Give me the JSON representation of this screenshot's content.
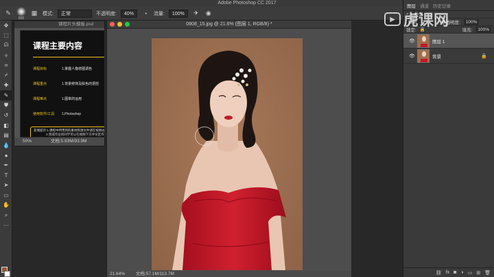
{
  "app": {
    "window_title": "Adobe Photoshop CC 2017"
  },
  "options_bar": {
    "brush_size": "600",
    "mode_label": "模式:",
    "mode_value": "正常",
    "opacity_label": "不透明度:",
    "opacity_value": "40%",
    "flow_label": "流量:",
    "flow_value": "100%"
  },
  "doc_slide": {
    "tab_title": "课程片头模板.psd",
    "heading": "课程主要内容",
    "rows": [
      {
        "key": "课程目标",
        "value": "1.掌握人像修图调色"
      },
      {
        "key": "课程重点",
        "value": "1.背景修饰及肤色的把控"
      },
      {
        "key": "课程难点",
        "value": "1.图章的运用"
      },
      {
        "key": "使用软件/工具",
        "value": "1.Photoshop"
      }
    ],
    "note_line1": "友情提示:1.课程中所用到的素材和源文件请在视频左",
    "note_line2": "2.完成作业的同学可以在视频下方评论区作",
    "zoom": "50%",
    "doc_info": "文档:5.93M/93.9M"
  },
  "doc_main": {
    "tab_title": "0808_15.jpg @ 21.6% (图层 1, RGB/8) *",
    "zoom": "21.64%",
    "doc_info": "文档:57.1M/113.7M"
  },
  "layers_panel": {
    "tabs": [
      "图层",
      "通道",
      "历史记录"
    ],
    "kind_label": "类型",
    "blend_mode": "正常",
    "opacity_label": "不透明度:",
    "opacity_value": "100%",
    "lock_label": "锁定:",
    "fill_label": "填充:",
    "fill_value": "100%",
    "layers": [
      {
        "name": "图层 1",
        "selected": true
      },
      {
        "name": "背景",
        "selected": false
      }
    ]
  },
  "watermark": {
    "text": "虎课网"
  },
  "colors": {
    "foreground": "#8b5b3a",
    "background": "#ffffff",
    "accent_yellow": "#f2c21a",
    "canvas_bg": "#9d6f4d",
    "dress_red": "#c41628"
  }
}
